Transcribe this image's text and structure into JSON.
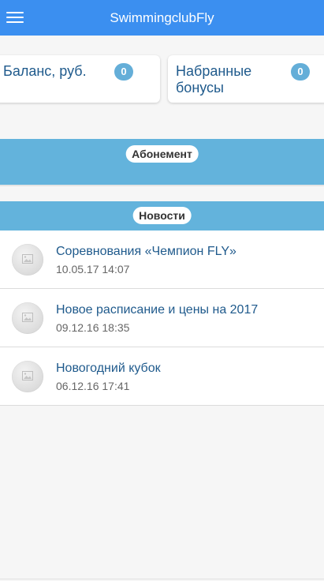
{
  "header": {
    "title": "SwimmingclubFly",
    "menu_icon": "hamburger-menu-icon"
  },
  "balance_card": {
    "label": "Баланс, руб.",
    "value": "0"
  },
  "bonus_card": {
    "label": "Набранные бонусы",
    "value": "0"
  },
  "sections": {
    "subscription": "Абонемент",
    "news": "Новости"
  },
  "news": [
    {
      "title": "Соревнования «Чемпион FLY»",
      "date": "10.05.17 14:07"
    },
    {
      "title": "Новое расписание и цены на 2017",
      "date": "09.12.16 18:35"
    },
    {
      "title": "Новогодний кубок",
      "date": "06.12.16 17:41"
    }
  ],
  "colors": {
    "header_bg": "#3b8ff0",
    "section_bg": "#63b3dc",
    "badge_bg": "#64aed8",
    "link_text": "#1f5a8c"
  }
}
